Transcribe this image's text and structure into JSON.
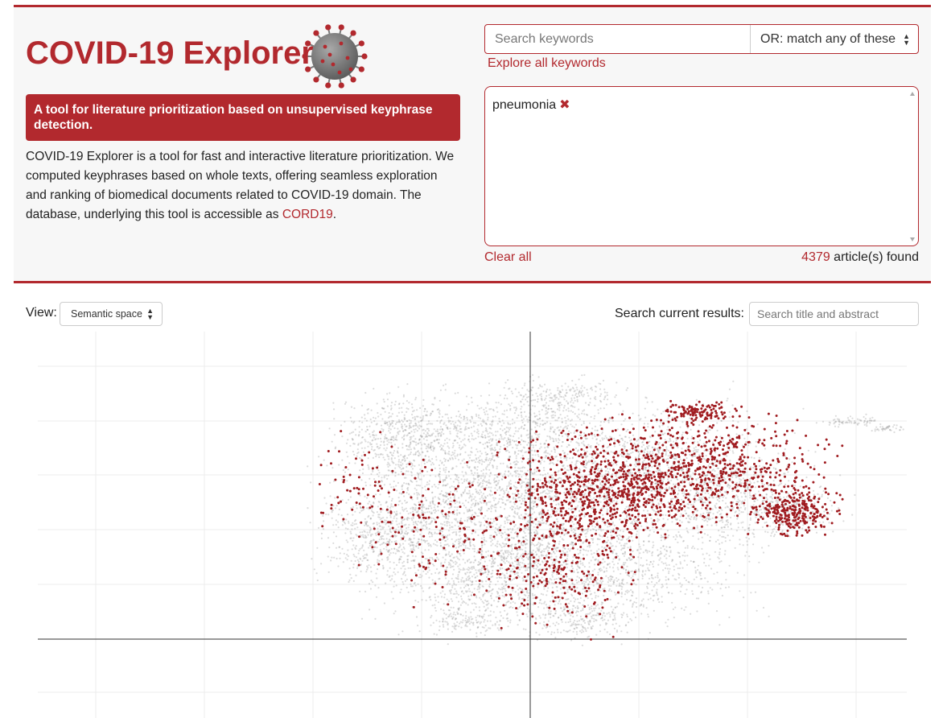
{
  "header": {
    "title": "COVID-19 Explorer",
    "tagline": "A tool for literature prioritization based on unsupervised keyphrase detection.",
    "description": "COVID-19 Explorer is a tool for fast and interactive literature prioritization. We computed keyphrases based on whole texts, offering seamless exploration and ranking of biomedical documents related to COVID-19 domain. The database, underlying this tool is accessible as",
    "cord_link": "CORD19",
    "cord_suffix": "."
  },
  "keywords": {
    "placeholder": "Search keywords",
    "match_mode": "OR: match any of these",
    "explore_link": "Explore all keywords",
    "selected": [
      "pneumonia"
    ],
    "remove_icon": "✖",
    "clear_all": "Clear all",
    "found_count": "4379",
    "found_suffix": " article(s) found"
  },
  "controls": {
    "view_label": "View:",
    "view_value": "Semantic space",
    "search_label": "Search current results:",
    "search_placeholder": "Search title and abstract"
  },
  "colors": {
    "accent": "#b2292e",
    "points_bg": "#9a9a9a",
    "points_hit": "#a01c20"
  },
  "chart_data": {
    "type": "scatter",
    "title": "",
    "xlabel": "",
    "ylabel": "",
    "grid": true,
    "series": [
      {
        "count_approx": 30000,
        "color": "#9a9a9a"
      },
      {
        "name": "pneumonia",
        "count": 4379,
        "color": "#a01c20"
      }
    ]
  }
}
